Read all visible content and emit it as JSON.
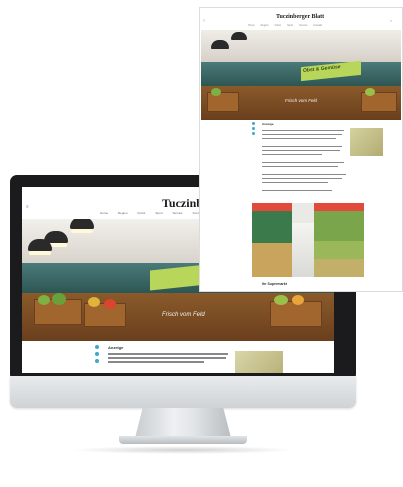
{
  "site": {
    "logo": "Tuczinberger Blatt",
    "nav": [
      "Home",
      "Region",
      "Kultur",
      "Sport",
      "Service",
      "Kontakt"
    ],
    "hero_caption": "Frisch vom Feld"
  },
  "imac_article": {
    "kicker": "Anzeige"
  },
  "page": {
    "logo": "Tuczinberger Blatt",
    "hero_sign": "Obst & Gemüse",
    "hero_caption": "Frisch vom Feld",
    "kicker": "Anzeige",
    "footer_title": "Ihr Supermarkt"
  },
  "colors": {
    "accent": "#3fa7c9",
    "sign": "#b7d65a",
    "imac_bezel": "#1b1b1d"
  }
}
